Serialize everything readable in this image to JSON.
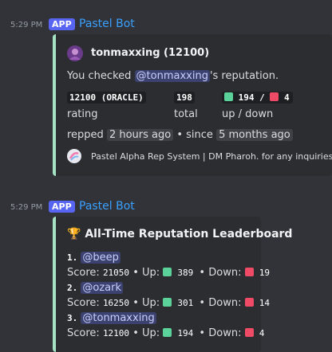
{
  "messages": [
    {
      "time": "5:29 PM",
      "badge": "APP",
      "bot": "Pastel Bot",
      "embed": {
        "author": "tonmaxxing (12100)",
        "desc_prefix": "You checked ",
        "desc_mention": "@tonmaxxing",
        "desc_suffix": "'s reputation.",
        "fields": [
          {
            "value": "12100 (ORACLE)",
            "label": "rating"
          },
          {
            "value": "198",
            "label": "total"
          },
          {
            "value_up": "194",
            "sep": " / ",
            "value_down": "4",
            "label": "up / down"
          }
        ],
        "repped_prefix": "repped ",
        "repped_time": "2 hours ago",
        "since_prefix": " • since ",
        "since_time": "5 months ago",
        "footer": "Pastel Alpha Rep System | DM Pharoh. for any inquiries."
      }
    },
    {
      "time": "5:29 PM",
      "badge": "APP",
      "bot": "Pastel Bot",
      "embed": {
        "title": "All-Time Reputation Leaderboard",
        "entries": [
          {
            "rank": "1.",
            "user": "@beep",
            "score": "21050",
            "up": "389",
            "down": "19"
          },
          {
            "rank": "2.",
            "user": "@ozark",
            "score": "16250",
            "up": "301",
            "down": "14"
          },
          {
            "rank": "3.",
            "user": "@tonmaxxing",
            "score": "12100",
            "up": "194",
            "down": "4"
          }
        ],
        "score_label": "Score: ",
        "up_label": " • Up: ",
        "down_label": " • Down: "
      }
    }
  ],
  "colors": {
    "accent": "#a6e3c4",
    "bot_name": "#3aa0ff",
    "badge": "#5865f2"
  }
}
